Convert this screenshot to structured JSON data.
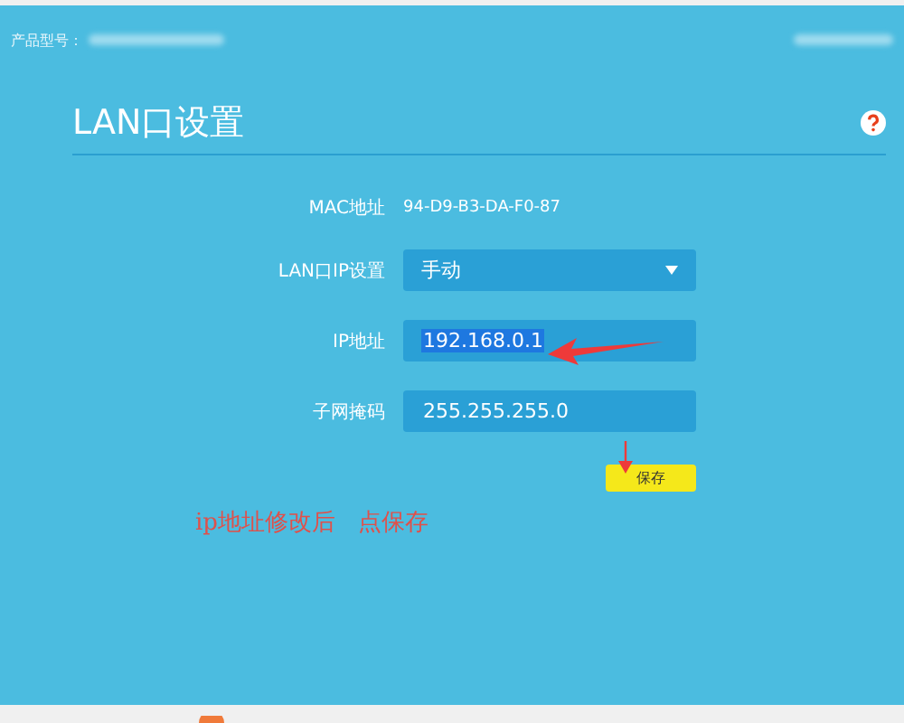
{
  "header": {
    "product_label": "产品型号："
  },
  "page": {
    "title": "LAN口设置"
  },
  "fields": [
    {
      "kind": "text",
      "label": "MAC地址",
      "value": "94-D9-B3-DA-F0-87"
    },
    {
      "kind": "select",
      "label": "LAN口IP设置",
      "value": "手动"
    },
    {
      "kind": "input",
      "label": "IP地址",
      "value": "192.168.0.1",
      "highlighted": true
    },
    {
      "kind": "input",
      "label": "子网掩码",
      "value": "255.255.255.0",
      "highlighted": false
    }
  ],
  "save_button": "保存",
  "annotation": "ip地址修改后   点保存"
}
